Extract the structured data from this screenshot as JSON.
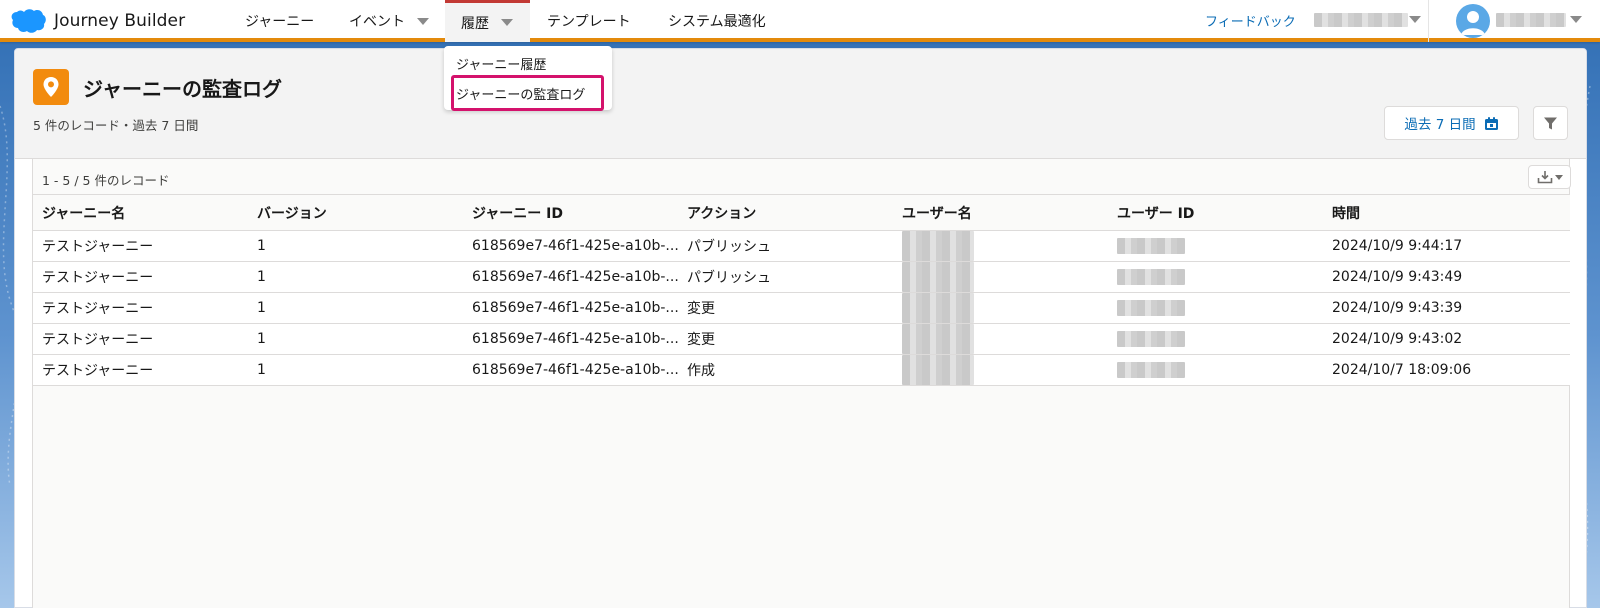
{
  "app": {
    "name": "Journey Builder"
  },
  "nav": {
    "items": [
      {
        "label": "ジャーニー"
      },
      {
        "label": "イベント"
      },
      {
        "label": "履歴"
      },
      {
        "label": "テンプレート"
      },
      {
        "label": "システム最適化"
      }
    ],
    "feedback": "フィードバック",
    "accent_color": "#e38a0c",
    "active_indicator_color": "#c23934"
  },
  "history_menu": {
    "items": [
      {
        "label": "ジャーニー履歴"
      },
      {
        "label": "ジャーニーの監査ログ"
      }
    ],
    "highlight_color": "#d4126c"
  },
  "page": {
    "title": "ジャーニーの監査ログ",
    "subtitle": "5 件のレコード・過去 7 日間",
    "icon": "map-pin-icon",
    "icon_color": "#f28b0e",
    "date_range_label": "過去 7 日間"
  },
  "table": {
    "record_count": "1 - 5 / 5 件のレコード",
    "columns": [
      "ジャーニー名",
      "バージョン",
      "ジャーニー ID",
      "アクション",
      "ユーザー名",
      "ユーザー ID",
      "時間"
    ],
    "rows": [
      {
        "name": "テストジャーニー",
        "version": "1",
        "journey_id": "618569e7-46f1-425e-a10b-...",
        "action": "パブリッシュ",
        "time": "2024/10/9 9:44:17"
      },
      {
        "name": "テストジャーニー",
        "version": "1",
        "journey_id": "618569e7-46f1-425e-a10b-...",
        "action": "パブリッシュ",
        "time": "2024/10/9 9:43:49"
      },
      {
        "name": "テストジャーニー",
        "version": "1",
        "journey_id": "618569e7-46f1-425e-a10b-...",
        "action": "変更",
        "time": "2024/10/9 9:43:39"
      },
      {
        "name": "テストジャーニー",
        "version": "1",
        "journey_id": "618569e7-46f1-425e-a10b-...",
        "action": "変更",
        "time": "2024/10/9 9:43:02"
      },
      {
        "name": "テストジャーニー",
        "version": "1",
        "journey_id": "618569e7-46f1-425e-a10b-...",
        "action": "作成",
        "time": "2024/10/7 18:09:06"
      }
    ]
  }
}
